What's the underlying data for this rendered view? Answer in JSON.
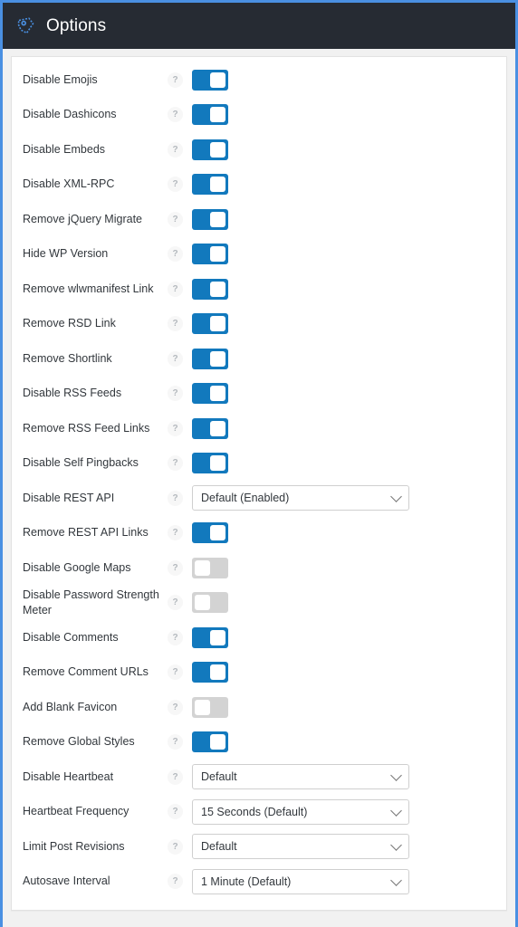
{
  "header": {
    "title": "Options",
    "icon": "plugin-logo-icon",
    "background_color": "#262b33",
    "accent_color": "#4a90e2"
  },
  "theme": {
    "toggle_on_color": "#1279bd",
    "toggle_off_color": "#d3d3d3",
    "card_background": "#ffffff",
    "page_background": "#f1f1f1",
    "text_color": "#32373c"
  },
  "help_icon": "?",
  "options": [
    {
      "label": "Disable Emojis",
      "control": "toggle",
      "state": "on"
    },
    {
      "label": "Disable Dashicons",
      "control": "toggle",
      "state": "on"
    },
    {
      "label": "Disable Embeds",
      "control": "toggle",
      "state": "on"
    },
    {
      "label": "Disable XML-RPC",
      "control": "toggle",
      "state": "on"
    },
    {
      "label": "Remove jQuery Migrate",
      "control": "toggle",
      "state": "on"
    },
    {
      "label": "Hide WP Version",
      "control": "toggle",
      "state": "on"
    },
    {
      "label": "Remove wlwmanifest Link",
      "control": "toggle",
      "state": "on"
    },
    {
      "label": "Remove RSD Link",
      "control": "toggle",
      "state": "on"
    },
    {
      "label": "Remove Shortlink",
      "control": "toggle",
      "state": "on"
    },
    {
      "label": "Disable RSS Feeds",
      "control": "toggle",
      "state": "on"
    },
    {
      "label": "Remove RSS Feed Links",
      "control": "toggle",
      "state": "on"
    },
    {
      "label": "Disable Self Pingbacks",
      "control": "toggle",
      "state": "on"
    },
    {
      "label": "Disable REST API",
      "control": "select",
      "value": "Default (Enabled)"
    },
    {
      "label": "Remove REST API Links",
      "control": "toggle",
      "state": "on"
    },
    {
      "label": "Disable Google Maps",
      "control": "toggle",
      "state": "off"
    },
    {
      "label": "Disable Password Strength Meter",
      "control": "toggle",
      "state": "off"
    },
    {
      "label": "Disable Comments",
      "control": "toggle",
      "state": "on"
    },
    {
      "label": "Remove Comment URLs",
      "control": "toggle",
      "state": "on"
    },
    {
      "label": "Add Blank Favicon",
      "control": "toggle",
      "state": "off"
    },
    {
      "label": "Remove Global Styles",
      "control": "toggle",
      "state": "on"
    },
    {
      "label": "Disable Heartbeat",
      "control": "select",
      "value": "Default"
    },
    {
      "label": "Heartbeat Frequency",
      "control": "select",
      "value": "15 Seconds (Default)"
    },
    {
      "label": "Limit Post Revisions",
      "control": "select",
      "value": "Default"
    },
    {
      "label": "Autosave Interval",
      "control": "select",
      "value": "1 Minute (Default)"
    }
  ]
}
